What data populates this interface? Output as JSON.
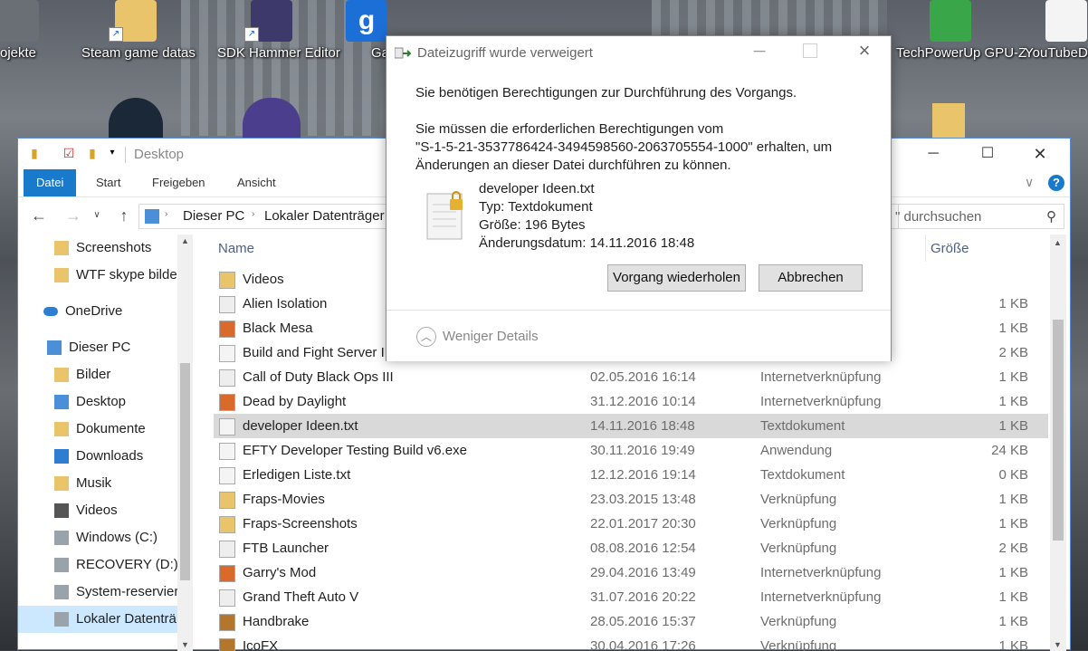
{
  "desktop": {
    "icons": [
      {
        "label": "ojekte"
      },
      {
        "label": "Steam game datas"
      },
      {
        "label": "SDK Hammer Editor"
      },
      {
        "label": "Ga"
      },
      {
        "label": "TechPowerUp GPU-Z"
      },
      {
        "label": "YouTubeD"
      }
    ]
  },
  "explorer": {
    "title": "Desktop",
    "ribbon_tabs": [
      "Datei",
      "Start",
      "Freigeben",
      "Ansicht"
    ],
    "breadcrumb": [
      "Dieser PC",
      "Lokaler Datenträger"
    ],
    "search_placeholder": "\" durchsuchen",
    "columns": {
      "name": "Name",
      "size": "Größe"
    },
    "nav_items": [
      {
        "label": "Screenshots",
        "icon": "folder-icon"
      },
      {
        "label": "WTF skype bilde",
        "icon": "folder-icon"
      },
      {
        "label": "OneDrive",
        "icon": "cloud-icon"
      },
      {
        "label": "Dieser PC",
        "icon": "pc-icon"
      },
      {
        "label": "Bilder",
        "icon": "pictures-icon"
      },
      {
        "label": "Desktop",
        "icon": "desktop-icon"
      },
      {
        "label": "Dokumente",
        "icon": "documents-icon"
      },
      {
        "label": "Downloads",
        "icon": "downloads-icon"
      },
      {
        "label": "Musik",
        "icon": "music-icon"
      },
      {
        "label": "Videos",
        "icon": "videos-icon"
      },
      {
        "label": "Windows (C:)",
        "icon": "drive-icon"
      },
      {
        "label": "RECOVERY (D:)",
        "icon": "drive-icon"
      },
      {
        "label": "System-reservier",
        "icon": "drive-icon"
      },
      {
        "label": "Lokaler Datenträ",
        "icon": "drive-icon"
      }
    ],
    "files": [
      {
        "name": "Videos",
        "date": "",
        "type": "",
        "size": "",
        "icon": "folder-icon"
      },
      {
        "name": "Alien Isolation",
        "date": "",
        "type": "",
        "size": "1 KB",
        "icon": "shortcut-icon"
      },
      {
        "name": "Black Mesa",
        "date": "",
        "type": "",
        "size": "1 KB",
        "icon": "game-icon"
      },
      {
        "name": "Build and Fight Server IP",
        "date": "",
        "type": "",
        "size": "2 KB",
        "icon": "text-file-icon"
      },
      {
        "name": "Call of Duty Black Ops III",
        "date": "02.05.2016 16:14",
        "type": "Internetverknüpfung",
        "size": "1 KB",
        "icon": "shortcut-icon"
      },
      {
        "name": "Dead by Daylight",
        "date": "31.12.2016 10:14",
        "type": "Internetverknüpfung",
        "size": "1 KB",
        "icon": "game-icon"
      },
      {
        "name": "developer Ideen.txt",
        "date": "14.11.2016 18:48",
        "type": "Textdokument",
        "size": "1 KB",
        "icon": "text-file-icon"
      },
      {
        "name": "EFTY Developer Testing Build v6.exe",
        "date": "30.11.2016 19:49",
        "type": "Anwendung",
        "size": "24 KB",
        "icon": "exe-icon"
      },
      {
        "name": "Erledigen Liste.txt",
        "date": "12.12.2016 19:14",
        "type": "Textdokument",
        "size": "0 KB",
        "icon": "text-file-icon"
      },
      {
        "name": "Fraps-Movies",
        "date": "23.03.2015 13:48",
        "type": "Verknüpfung",
        "size": "1 KB",
        "icon": "folder-shortcut-icon"
      },
      {
        "name": "Fraps-Screenshots",
        "date": "22.01.2017 20:30",
        "type": "Verknüpfung",
        "size": "1 KB",
        "icon": "folder-shortcut-icon"
      },
      {
        "name": "FTB Launcher",
        "date": "08.08.2016 12:54",
        "type": "Verknüpfung",
        "size": "2 KB",
        "icon": "shortcut-icon"
      },
      {
        "name": "Garry's Mod",
        "date": "29.04.2016 13:49",
        "type": "Internetverknüpfung",
        "size": "1 KB",
        "icon": "game-icon"
      },
      {
        "name": "Grand Theft Auto V",
        "date": "31.07.2016 20:22",
        "type": "Internetverknüpfung",
        "size": "1 KB",
        "icon": "shortcut-icon"
      },
      {
        "name": "Handbrake",
        "date": "28.05.2016 15:37",
        "type": "Verknüpfung",
        "size": "1 KB",
        "icon": "app-icon"
      },
      {
        "name": "IcoFX",
        "date": "30.04.2016 17:26",
        "type": "Verknüpfung",
        "size": "1 KB",
        "icon": "app-icon"
      }
    ]
  },
  "dialog": {
    "title": "Dateizugriff wurde verweigert",
    "line1": "Sie benötigen Berechtigungen zur Durchführung des Vorgangs.",
    "line2": "Sie müssen die erforderlichen Berechtigungen vom",
    "line3": "\"S-1-5-21-3537786424-3494598560-2063705554-1000\" erhalten, um",
    "line4": "Änderungen an dieser Datei durchführen zu können.",
    "file_name": "developer Ideen.txt",
    "file_type": "Typ: Textdokument",
    "file_size": "Größe: 196 Bytes",
    "file_date": "Änderungsdatum: 14.11.2016 18:48",
    "retry_label": "Vorgang wiederholen",
    "cancel_label": "Abbrechen",
    "details_label": "Weniger Details"
  },
  "colors": {
    "accent": "#1979ca",
    "selection": "#d9d9d9",
    "nav_selection": "#cce8ff"
  }
}
